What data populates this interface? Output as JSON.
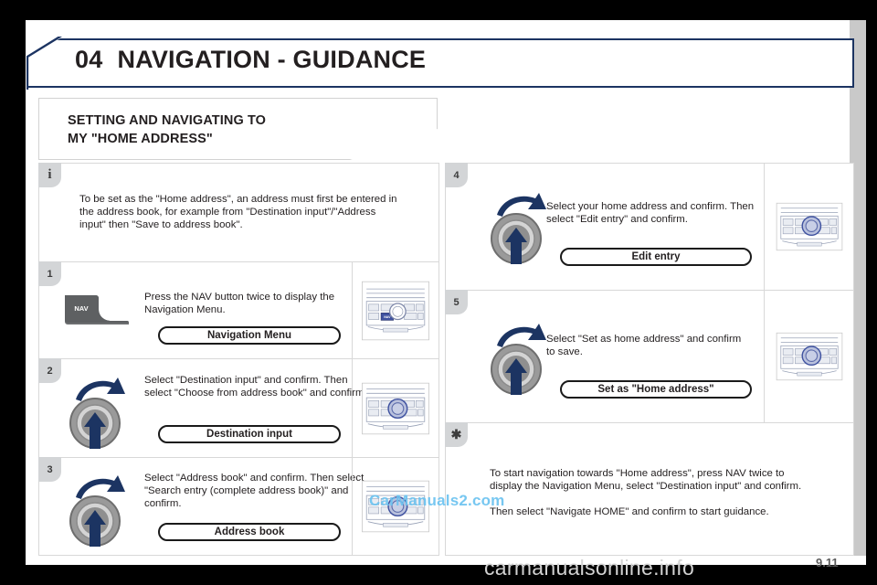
{
  "header": {
    "number": "04",
    "title": "NAVIGATION - GUIDANCE"
  },
  "section": {
    "line1": "SETTING AND NAVIGATING TO",
    "line2": "MY \"HOME ADDRESS\""
  },
  "info_note": {
    "badge": "i",
    "text": "To be set as the \"Home address\", an address must first be entered in the address book, for example from \"Destination input\"/\"Address input\" then \"Save to address book\"."
  },
  "steps": [
    {
      "number": "1",
      "icon": "nav-button-icon",
      "icon_label": "NAV",
      "text": "Press the NAV button twice to display the Navigation Menu.",
      "pill": "Navigation Menu",
      "thumbnail": "car-radio-faceplate-nav-highlighted"
    },
    {
      "number": "2",
      "icon": "rotary-knob-icon",
      "text": "Select \"Destination input\" and confirm. Then select \"Choose from address book\" and confirm.",
      "pill": "Destination input",
      "thumbnail": "car-radio-faceplate-knob-highlighted"
    },
    {
      "number": "3",
      "icon": "rotary-knob-icon",
      "text": "Select \"Address book\" and confirm. Then select \"Search entry (complete address book)\" and confirm.",
      "pill": "Address book",
      "thumbnail": "car-radio-faceplate-knob-highlighted"
    },
    {
      "number": "4",
      "icon": "rotary-knob-icon",
      "text": "Select your home address and confirm. Then select \"Edit entry\" and confirm.",
      "pill": "Edit entry",
      "thumbnail": "car-radio-faceplate-knob-highlighted"
    },
    {
      "number": "5",
      "icon": "rotary-knob-icon",
      "text": "Select \"Set as home address\" and confirm to save.",
      "pill": "Set as \"Home address\"",
      "thumbnail": "car-radio-faceplate-knob-highlighted"
    }
  ],
  "tip_note": {
    "badge": "asterisk-icon",
    "paragraph1": "To start navigation towards \"Home address\", press NAV twice to display the Navigation Menu, select \"Destination input\" and confirm.",
    "paragraph2": "Then select \"Navigate HOME\" and confirm to start guidance."
  },
  "watermarks": {
    "middle": "CarManuals2.com",
    "bottom": "carmanualsonline.info"
  },
  "page_number": "9.11",
  "colors": {
    "header_border": "#1c3462",
    "badge_bg": "#d3d5d7",
    "arrow_navy": "#1c3462",
    "watermark_blue": "#6cc3f0"
  }
}
